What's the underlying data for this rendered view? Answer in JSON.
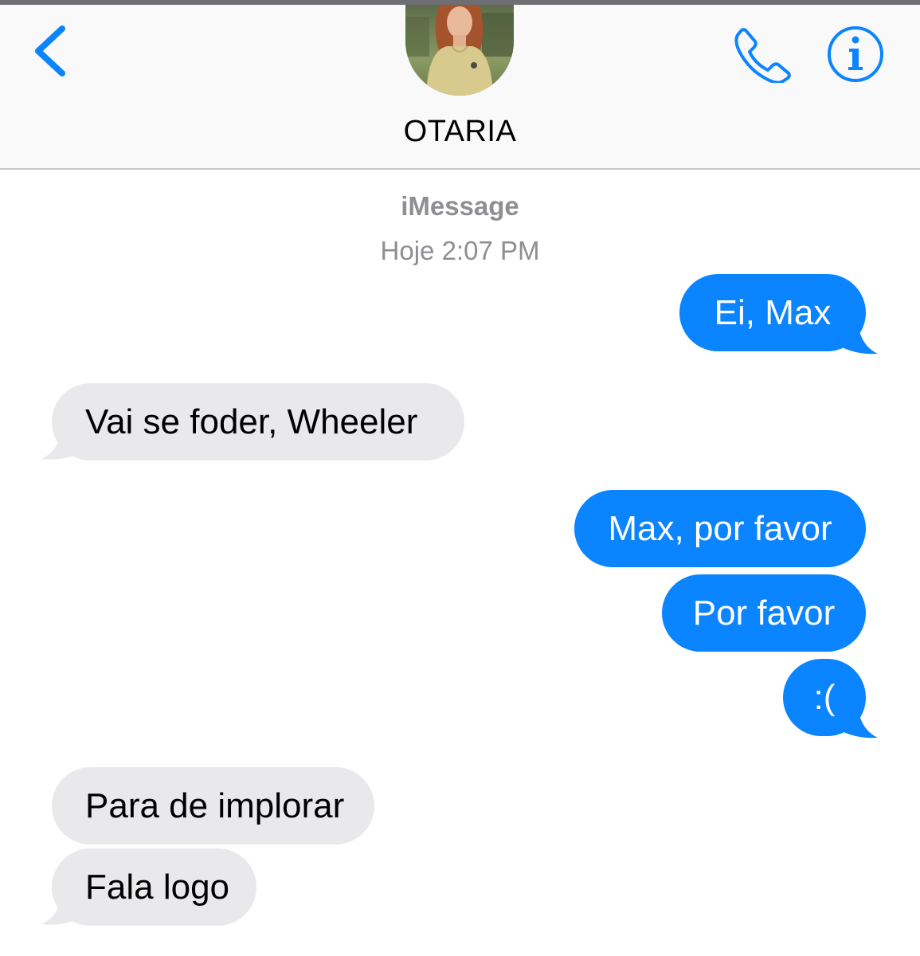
{
  "header": {
    "contact_name": "OTARIA",
    "back_icon": "chevron-left-icon",
    "call_icon": "phone-icon",
    "info_icon": "info-icon",
    "accent_color": "#0a84ff"
  },
  "conversation": {
    "service": "iMessage",
    "timestamp": "Hoje 2:07 PM"
  },
  "messages": [
    {
      "direction": "sent",
      "text": "Ei, Max"
    },
    {
      "direction": "received",
      "text": "Vai se foder, Wheeler"
    },
    {
      "direction": "sent",
      "text": "Max, por favor"
    },
    {
      "direction": "sent",
      "text": "Por favor"
    },
    {
      "direction": "sent",
      "text": ":("
    },
    {
      "direction": "received",
      "text": "Para de implorar"
    },
    {
      "direction": "received",
      "text": "Fala logo"
    }
  ],
  "colors": {
    "sent_bubble": "#0a84ff",
    "received_bubble": "#e9e9eb",
    "meta_text": "#8e8e93"
  }
}
